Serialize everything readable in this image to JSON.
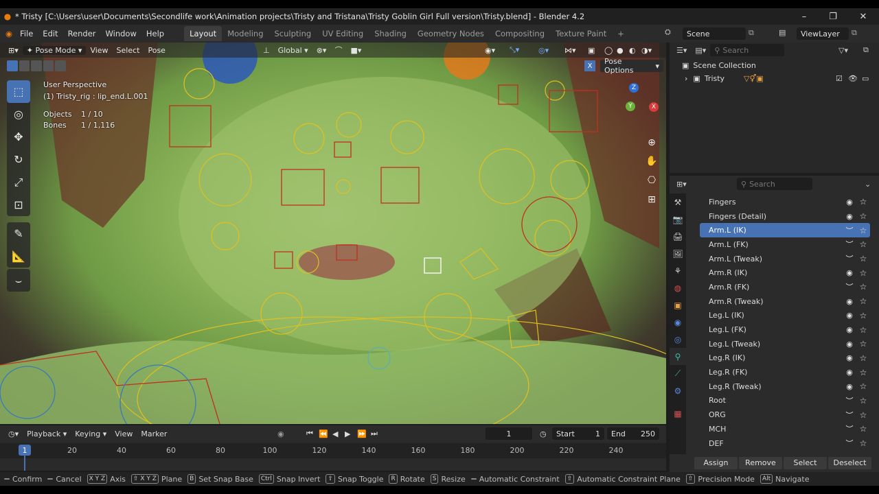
{
  "window": {
    "title": "* Tristy [C:\\Users\\user\\Documents\\Secondlife work\\Animation projects\\Tristy and Tristana\\Tristy Goblin Girl Full version\\Tristy.blend] - Blender 4.2",
    "minimize": "–",
    "maximize": "❐",
    "close": "✕"
  },
  "menu": [
    "File",
    "Edit",
    "Render",
    "Window",
    "Help"
  ],
  "workspaces": [
    "Layout",
    "Modeling",
    "Sculpting",
    "UV Editing",
    "Shading",
    "Geometry Nodes",
    "Compositing",
    "Texture Paint"
  ],
  "workspace_add": "+",
  "scene": {
    "label": "Scene",
    "view_layer": "ViewLayer"
  },
  "viewport": {
    "mode": "Pose Mode",
    "menus": [
      "View",
      "Select",
      "Pose"
    ],
    "orientation": "Global",
    "pose_options": "Pose Options",
    "info": {
      "perspective": "User Perspective",
      "active": "(1) Tristy_rig : lip_end.L.001",
      "objects_label": "Objects",
      "objects_value": "1 / 10",
      "bones_label": "Bones",
      "bones_value": "1 / 1,116"
    },
    "gizmo": {
      "x": "X",
      "y": "Y",
      "z": "Z"
    }
  },
  "timeline": {
    "menus": [
      "Playback",
      "Keying",
      "View",
      "Marker"
    ],
    "current_frame": "1",
    "start_label": "Start",
    "start_value": "1",
    "end_label": "End",
    "end_value": "250",
    "ruler": [
      "20",
      "40",
      "60",
      "80",
      "100",
      "120",
      "140",
      "160",
      "180",
      "200",
      "220",
      "240"
    ],
    "playhead": "1"
  },
  "status": [
    {
      "key": "",
      "label": "Confirm"
    },
    {
      "key": "",
      "label": "Cancel"
    },
    {
      "key": "X Y Z",
      "label": "Axis"
    },
    {
      "key": "⇧ X Y Z",
      "label": "Plane"
    },
    {
      "key": "B",
      "label": "Set Snap Base"
    },
    {
      "key": "Ctrl",
      "label": "Snap Invert"
    },
    {
      "key": "⇧",
      "label": "Snap Toggle"
    },
    {
      "key": "R",
      "label": "Rotate"
    },
    {
      "key": "S",
      "label": "Resize"
    },
    {
      "key": "",
      "label": "Automatic Constraint"
    },
    {
      "key": "⇧",
      "label": "Automatic Constraint Plane"
    },
    {
      "key": "⇧",
      "label": "Precision Mode"
    },
    {
      "key": "Alt",
      "label": "Navigate"
    }
  ],
  "outliner": {
    "search_placeholder": "Search",
    "scene_collection": "Scene Collection",
    "object": "Tristy"
  },
  "properties": {
    "search_placeholder": "Search",
    "bone_collections": [
      {
        "name": "Fingers",
        "visible": true,
        "selected": false
      },
      {
        "name": "Fingers (Detail)",
        "visible": true,
        "selected": false
      },
      {
        "name": "Arm.L (IK)",
        "visible": false,
        "selected": true
      },
      {
        "name": "Arm.L (FK)",
        "visible": false,
        "selected": false
      },
      {
        "name": "Arm.L (Tweak)",
        "visible": false,
        "selected": false
      },
      {
        "name": "Arm.R (IK)",
        "visible": true,
        "selected": false
      },
      {
        "name": "Arm.R (FK)",
        "visible": false,
        "selected": false
      },
      {
        "name": "Arm.R (Tweak)",
        "visible": true,
        "selected": false
      },
      {
        "name": "Leg.L (IK)",
        "visible": true,
        "selected": false
      },
      {
        "name": "Leg.L (FK)",
        "visible": true,
        "selected": false
      },
      {
        "name": "Leg.L (Tweak)",
        "visible": true,
        "selected": false
      },
      {
        "name": "Leg.R (IK)",
        "visible": true,
        "selected": false
      },
      {
        "name": "Leg.R (FK)",
        "visible": true,
        "selected": false
      },
      {
        "name": "Leg.R (Tweak)",
        "visible": true,
        "selected": false
      },
      {
        "name": "Root",
        "visible": false,
        "selected": false
      },
      {
        "name": "ORG",
        "visible": false,
        "selected": false
      },
      {
        "name": "MCH",
        "visible": false,
        "selected": false
      },
      {
        "name": "DEF",
        "visible": false,
        "selected": false
      }
    ],
    "buttons": [
      "Assign",
      "Remove",
      "Select",
      "Deselect"
    ]
  },
  "colors": {
    "accent": "#4772b3",
    "blender_orange": "#e87d0d",
    "bone_yellow": "#e0c020",
    "bone_red": "#c03020",
    "skin_green": "#8eb65c"
  }
}
